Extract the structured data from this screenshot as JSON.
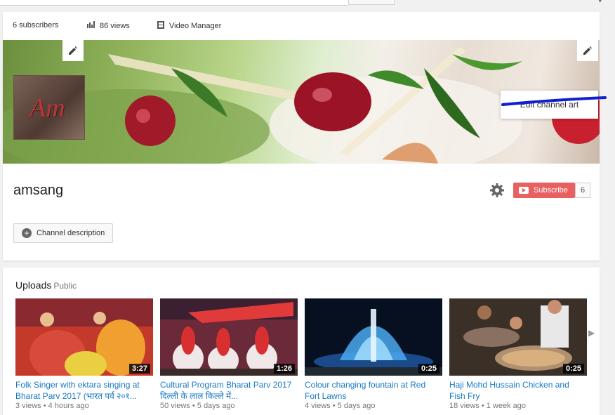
{
  "stats": {
    "subscribers": "6 subscribers",
    "views": "86 views",
    "video_manager": "Video Manager"
  },
  "banner": {
    "avatar_text": "Am",
    "edit_channel_art": "Edit channel art"
  },
  "channel": {
    "name": "amsang",
    "subscribe_label": "Subscribe",
    "subscriber_count": "6",
    "description_button": "Channel description"
  },
  "uploads": {
    "title": "Uploads",
    "visibility": "Public",
    "videos": [
      {
        "title": "Folk Singer with ektara singing at Bharat Parv 2017 (भारत पर्व २०१...",
        "duration": "3:27",
        "views": "3 views",
        "age": "4 hours ago"
      },
      {
        "title": "Cultural Program Bharat Parv 2017 दिल्ली के लाल किल्ले में...",
        "duration": "1:26",
        "views": "50 views",
        "age": "5 days ago"
      },
      {
        "title": "Colour changing fountain at Red Fort Lawns",
        "duration": "0:25",
        "views": "4 views",
        "age": "5 days ago"
      },
      {
        "title": "Haji Mohd Hussain Chicken and Fish Fry",
        "duration": "0:25",
        "views": "18 views",
        "age": "1 week ago"
      }
    ]
  },
  "colors": {
    "subscribe": "#e86060",
    "link": "#167ac6",
    "annotation": "#1020d0"
  }
}
